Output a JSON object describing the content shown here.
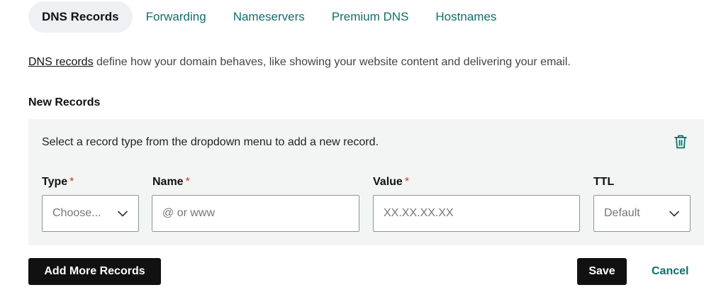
{
  "tabs": [
    {
      "label": "DNS Records",
      "active": true
    },
    {
      "label": "Forwarding",
      "active": false
    },
    {
      "label": "Nameservers",
      "active": false
    },
    {
      "label": "Premium DNS",
      "active": false
    },
    {
      "label": "Hostnames",
      "active": false
    }
  ],
  "description": {
    "link_text": "DNS records",
    "rest_text": " define how your domain behaves, like showing your website content and delivering your email."
  },
  "section_title": "New Records",
  "panel": {
    "instruction": "Select a record type from the dropdown menu to add a new record.",
    "delete_icon": "trash-icon",
    "fields": {
      "type": {
        "label": "Type",
        "required_mark": "*",
        "value": "Choose..."
      },
      "name": {
        "label": "Name",
        "required_mark": "*",
        "placeholder": "@ or www",
        "value": ""
      },
      "value": {
        "label": "Value",
        "required_mark": "*",
        "placeholder": "XX.XX.XX.XX",
        "value": ""
      },
      "ttl": {
        "label": "TTL",
        "value": "Default"
      }
    }
  },
  "buttons": {
    "add_more": "Add More Records",
    "save": "Save",
    "cancel": "Cancel"
  },
  "colors": {
    "accent": "#0f6f6b",
    "required": "#d0312d",
    "panel_bg": "#f3f5f5",
    "dark_button": "#111111"
  }
}
